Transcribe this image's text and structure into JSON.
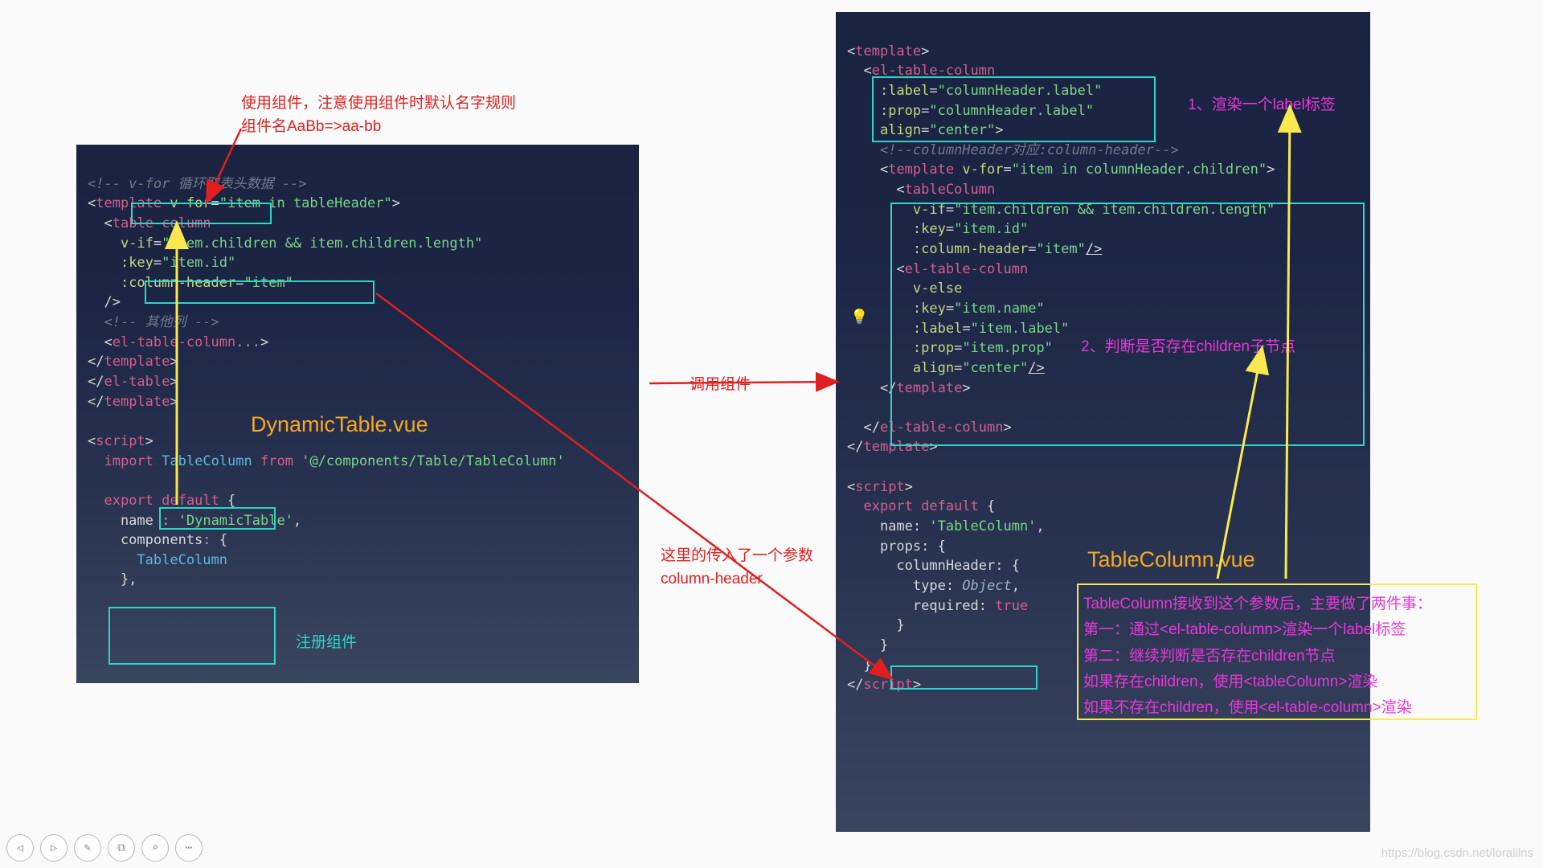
{
  "annotations": {
    "top_red_1": "使用组件，注意使用组件时默认名字规则",
    "top_red_2": "组件名AaBb=>aa-bb",
    "mid_red": "调用组件",
    "param_red_1": "这里的传入了一个参数",
    "param_red_2": "column-header",
    "register_cyan": "注册组件",
    "label_orange_left": "DynamicTable.vue",
    "label_orange_right": "TableColumn.vue",
    "step1_magenta": "1、渲染一个label标签",
    "step2_magenta": "2、判断是否存在children子节点",
    "box_magenta_1": "TableColumn接收到这个参数后，主要做了两件事：",
    "box_magenta_2_pre": "第一：通过",
    "box_magenta_2_tag": "<el-table-column>",
    "box_magenta_2_post": "渲染一个label标签",
    "box_magenta_3": "第二：继续判断是否存在children节点",
    "box_magenta_4_pre": "如果存在children，使用",
    "box_magenta_4_tag": "<tableColumn>",
    "box_magenta_4_post": "渲染",
    "box_magenta_5_pre": "如果不存在children，使用",
    "box_magenta_5_tag": "<el-table-column>",
    "box_magenta_5_post": "渲染"
  },
  "left_code": {
    "file_title": "DynamicTable.vue",
    "import_path": "'@/components/Table/TableColumn'",
    "component_name": "TableColumn",
    "name_value": "'DynamicTable'"
  },
  "right_code": {
    "file_title": "TableColumn.vue",
    "name_value": "'TableColumn'"
  },
  "toolbar_icons": [
    "prev",
    "next",
    "pen",
    "copy",
    "zoom",
    "more"
  ],
  "watermark": "https://blog.csdn.net/loralilns"
}
